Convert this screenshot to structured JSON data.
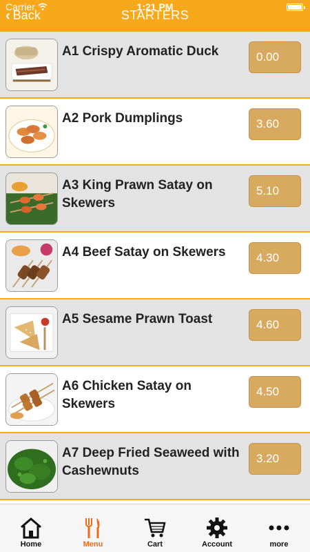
{
  "status": {
    "carrier": "Carrier",
    "time": "1:21 PM"
  },
  "header": {
    "back_label": "Back",
    "title": "STARTERS"
  },
  "items": [
    {
      "name": "A1 Crispy Aromatic Duck",
      "price": "0.00",
      "image_icon": "duck-dish-icon"
    },
    {
      "name": "A2 Pork Dumplings",
      "price": "3.60",
      "image_icon": "dumplings-dish-icon"
    },
    {
      "name": "A3 King Prawn Satay on Skewers",
      "price": "5.10",
      "image_icon": "prawn-satay-dish-icon"
    },
    {
      "name": "A4 Beef Satay on Skewers",
      "price": "4.30",
      "image_icon": "beef-satay-dish-icon"
    },
    {
      "name": "A5 Sesame Prawn Toast",
      "price": "4.60",
      "image_icon": "prawn-toast-dish-icon"
    },
    {
      "name": "A6 Chicken Satay on Skewers",
      "price": "4.50",
      "image_icon": "chicken-satay-dish-icon"
    },
    {
      "name": "A7 Deep Fried Seaweed with Cashewnuts",
      "price": "3.20",
      "image_icon": "seaweed-dish-icon"
    }
  ],
  "tabs": [
    {
      "label": "Home",
      "icon": "home-icon"
    },
    {
      "label": "Menu",
      "icon": "cutlery-icon"
    },
    {
      "label": "Cart",
      "icon": "cart-icon"
    },
    {
      "label": "Account",
      "icon": "gear-icon"
    },
    {
      "label": "more",
      "icon": "more-icon"
    }
  ],
  "colors": {
    "accent": "#f7a81b",
    "price_button": "#d8aa60",
    "active_tab": "#f06a18",
    "row_alt": "#e3e3e3"
  }
}
